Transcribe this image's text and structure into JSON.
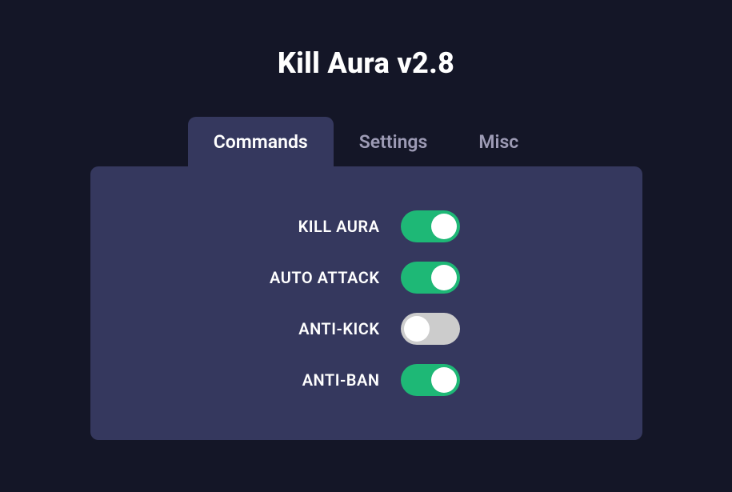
{
  "title": "Kill Aura v2.8",
  "tabs": {
    "commands": {
      "label": "Commands",
      "active": true
    },
    "settings": {
      "label": "Settings",
      "active": false
    },
    "misc": {
      "label": "Misc",
      "active": false
    }
  },
  "options": {
    "kill_aura": {
      "label": "KILL AURA",
      "enabled": true
    },
    "auto_attack": {
      "label": "AUTO ATTACK",
      "enabled": true
    },
    "anti_kick": {
      "label": "ANTI-KICK",
      "enabled": false
    },
    "anti_ban": {
      "label": "ANTI-BAN",
      "enabled": true
    }
  },
  "colors": {
    "bg": "#141627",
    "panel": "#35385e",
    "toggle_on": "#1eb876",
    "toggle_off": "#cccccc",
    "text": "#ffffff",
    "inactive_tab": "#9d9bb5"
  }
}
